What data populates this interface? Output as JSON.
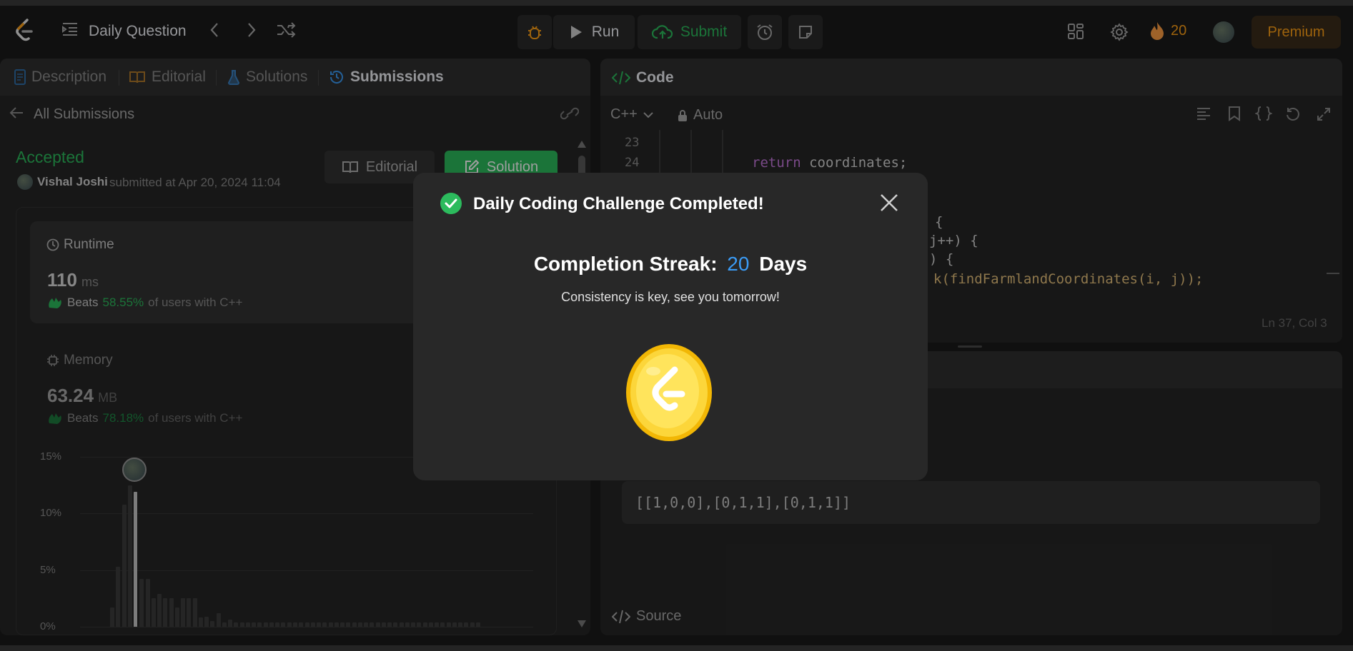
{
  "topbar": {
    "title": "Daily Question",
    "run_label": "Run",
    "submit_label": "Submit",
    "streak_count": "20",
    "premium_label": "Premium"
  },
  "left_tabs": {
    "description": "Description",
    "editorial": "Editorial",
    "solutions": "Solutions",
    "submissions": "Submissions"
  },
  "submission": {
    "back_label": "All Submissions",
    "status": "Accepted",
    "user": "Vishal Joshi",
    "submitted_text": "submitted at Apr 20, 2024 11:04",
    "editorial_button": "Editorial",
    "solution_button": "Solution",
    "runtime_label": "Runtime",
    "runtime_value": "110",
    "runtime_unit": "ms",
    "runtime_beats_prefix": "Beats",
    "runtime_beats_pct": "58.55%",
    "runtime_beats_suffix": "of users with C++",
    "memory_label": "Memory",
    "memory_value": "63.24",
    "memory_unit": "MB",
    "memory_beats_prefix": "Beats",
    "memory_beats_pct": "78.18%",
    "memory_beats_suffix": "of users with C++"
  },
  "chart_data": {
    "type": "bar",
    "y_ticks": [
      "15%",
      "10%",
      "5%",
      "0%"
    ],
    "ylim": [
      0,
      15
    ],
    "values": [
      1.7,
      5.3,
      10.8,
      12.5,
      11.9,
      4.2,
      4.2,
      2.5,
      2.9,
      2.5,
      2.5,
      1.7,
      2.5,
      2.5,
      2.5,
      0.8,
      0.9,
      0.5,
      1.2,
      0.4,
      0.6,
      0.4,
      0.4,
      0.4,
      0.4,
      0.4,
      0.4,
      0.4,
      0.4,
      0.4,
      0.4,
      0.4,
      0.4,
      0.4,
      0.4,
      0.4,
      0.4,
      0.4,
      0.4,
      0.4,
      0.4,
      0.4,
      0.4,
      0.4,
      0.4,
      0.4,
      0.4,
      0.4,
      0.4,
      0.4,
      0.4,
      0.4,
      0.4,
      0.4,
      0.4,
      0.4,
      0.4,
      0.4,
      0.4,
      0.4,
      0.4,
      0.4,
      0.4
    ],
    "highlight_index": 4
  },
  "code_panel": {
    "title": "Code",
    "language": "C++",
    "mode": "Auto",
    "line_numbers": [
      "23",
      "24"
    ],
    "line_24_keyword": "return",
    "line_24_rest": " coordinates;",
    "partial_lines": [
      "{",
      "j++) {",
      ") {",
      "k(findFarmlandCoordinates(i, j));"
    ],
    "cursor_position": "Ln 37, Col 3"
  },
  "output": {
    "value": "[[1,0,0],[0,1,1],[0,1,1]]",
    "source_label": "Source"
  },
  "modal": {
    "title": "Daily Coding Challenge Completed!",
    "streak_prefix": "Completion Streak:",
    "streak_value": "20",
    "streak_suffix": "Days",
    "message": "Consistency is key, see you tomorrow!"
  },
  "colors": {
    "accent_green": "#2cbb5d",
    "accent_blue": "#3b9bf5",
    "streak_orange": "#ffa116",
    "premium_text": "#ffa116"
  }
}
